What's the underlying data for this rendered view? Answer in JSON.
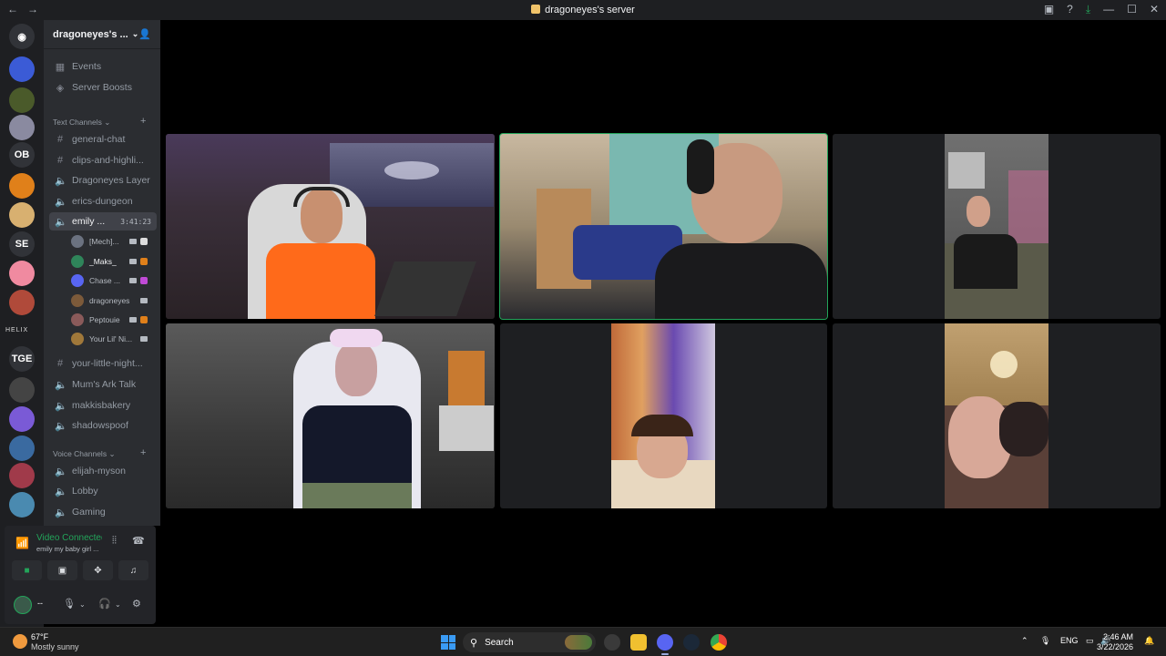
{
  "window": {
    "title": "dragoneyes's server",
    "nav": [
      "←",
      "→"
    ],
    "controls": [
      "inbox-icon",
      "help-icon",
      "download-icon",
      "—",
      "☐",
      "✕"
    ]
  },
  "guild_rail": {
    "labels": [
      "OB",
      "SE",
      "HELIX",
      "TGE"
    ]
  },
  "sidebar": {
    "server_name": "dragoneyes's ...",
    "top_items": [
      {
        "icon": "calendar-icon",
        "label": "Events"
      },
      {
        "icon": "boost-icon",
        "label": "Server Boosts"
      }
    ],
    "text_category": "Text Channels",
    "text_channels": [
      {
        "icon": "#",
        "label": "general-chat"
      },
      {
        "icon": "#",
        "label": "clips-and-highli..."
      },
      {
        "icon": "speaker",
        "label": "Dragoneyes Layer"
      },
      {
        "icon": "speaker",
        "label": "erics-dungeon"
      },
      {
        "icon": "speaker",
        "label": "emily ...",
        "active": true,
        "timer": "3:41:23"
      }
    ],
    "members": [
      {
        "name": "[Mech]...",
        "color": "#6b7280"
      },
      {
        "name": "_Maks_",
        "color": "#2f855a"
      },
      {
        "name": "Chase ...",
        "color": "#5865f2"
      },
      {
        "name": "dragoneyes",
        "color": "#7c5a3a"
      },
      {
        "name": "Peptouie",
        "color": "#8a5a5a"
      },
      {
        "name": "Your Lil' Ni...",
        "color": "#a0783a"
      }
    ],
    "more_text_channels": [
      {
        "icon": "#",
        "label": "your-little-night..."
      },
      {
        "icon": "speaker",
        "label": "Mum's Ark Talk"
      },
      {
        "icon": "speaker",
        "label": "makkisbakery"
      },
      {
        "icon": "speaker",
        "label": "shadowspoof"
      }
    ],
    "voice_category": "Voice Channels",
    "voice_channels": [
      {
        "icon": "speaker",
        "label": "elijah-myson"
      },
      {
        "icon": "speaker",
        "label": "Lobby"
      },
      {
        "icon": "speaker",
        "label": "Gaming"
      }
    ]
  },
  "voice_panel": {
    "status": "Video Connected",
    "channel": "emily my baby girl ...",
    "user_name": "--"
  },
  "taskbar": {
    "temp": "67°F",
    "weather": "Mostly sunny",
    "search": "Search",
    "lang": "ENG",
    "time": "2:46 AM",
    "date": "3/22/2026"
  },
  "colors": {
    "accent_green": "#23a55a",
    "sidebar_bg": "#2b2d31",
    "rail_bg": "#1e1f22"
  }
}
